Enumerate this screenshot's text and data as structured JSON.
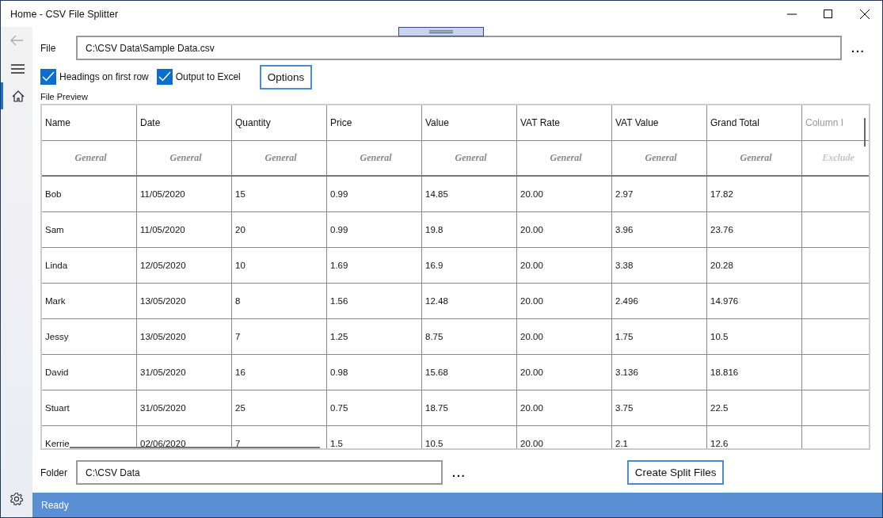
{
  "window": {
    "title": "Home - CSV File Splitter"
  },
  "nav": {
    "back_disabled": true,
    "items": [
      {
        "kind": "menu",
        "selected": false
      },
      {
        "kind": "home",
        "selected": true
      }
    ]
  },
  "file": {
    "label": "File",
    "value": "C:\\CSV Data\\Sample Data.csv",
    "browse": "..."
  },
  "options": [
    {
      "label": "Headings on first row",
      "checked": true
    },
    {
      "label": "Output to Excel",
      "checked": true
    }
  ],
  "options_button": "Options",
  "preview_label": "File Preview",
  "table": {
    "columns": [
      {
        "name": "Name",
        "format": "General",
        "excluded": false
      },
      {
        "name": "Date",
        "format": "General",
        "excluded": false
      },
      {
        "name": "Quantity",
        "format": "General",
        "excluded": false
      },
      {
        "name": "Price",
        "format": "General",
        "excluded": false
      },
      {
        "name": "Value",
        "format": "General",
        "excluded": false
      },
      {
        "name": "VAT Rate",
        "format": "General",
        "excluded": false
      },
      {
        "name": "VAT Value",
        "format": "General",
        "excluded": false
      },
      {
        "name": "Grand Total",
        "format": "General",
        "excluded": false
      },
      {
        "name": "Column I",
        "format": "Exclude",
        "excluded": true
      }
    ],
    "rows": [
      [
        "Bob",
        "11/05/2020",
        "15",
        "0.99",
        "14.85",
        "20.00",
        "2.97",
        "17.82",
        ""
      ],
      [
        "Sam",
        "11/05/2020",
        "20",
        "0.99",
        "19.8",
        "20.00",
        "3.96",
        "23.76",
        ""
      ],
      [
        "Linda",
        "12/05/2020",
        "10",
        "1.69",
        "16.9",
        "20.00",
        "3.38",
        "20.28",
        ""
      ],
      [
        "Mark",
        "13/05/2020",
        "8",
        "1.56",
        "12.48",
        "20.00",
        "2.496",
        "14.976",
        ""
      ],
      [
        "Jessy",
        "13/05/2020",
        "7",
        "1.25",
        "8.75",
        "20.00",
        "1.75",
        "10.5",
        ""
      ],
      [
        "David",
        "31/05/2020",
        "16",
        "0.98",
        "15.68",
        "20.00",
        "3.136",
        "18.816",
        ""
      ],
      [
        "Stuart",
        "31/05/2020",
        "25",
        "0.75",
        "18.75",
        "20.00",
        "3.75",
        "22.5",
        ""
      ],
      [
        "Kerrie",
        "02/06/2020",
        "7",
        "1.5",
        "10.5",
        "20.00",
        "2.1",
        "12.6",
        ""
      ]
    ]
  },
  "folder": {
    "label": "Folder",
    "value": "C:\\CSV Data",
    "browse": "..."
  },
  "create_button": "Create Split Files",
  "status_bar": "Ready"
}
